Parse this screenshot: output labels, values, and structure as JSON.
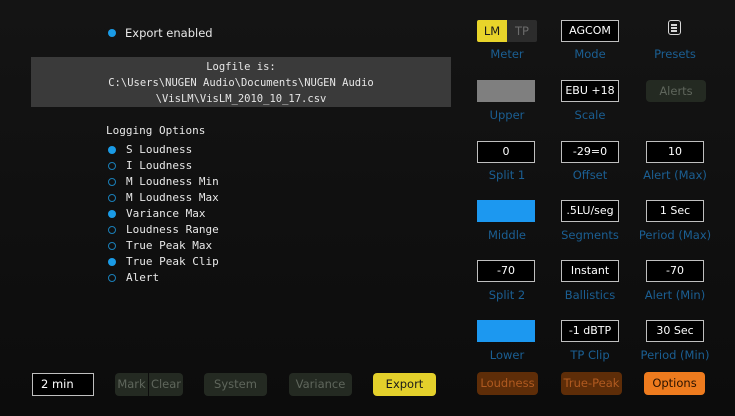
{
  "export": {
    "label": "Export enabled",
    "enabled": true
  },
  "logfile": {
    "title": "Logfile is:",
    "line1": "C:\\Users\\NUGEN Audio\\Documents\\NUGEN Audio",
    "line2": "\\VisLM\\VisLM_2010_10_17.csv"
  },
  "logging": {
    "title": "Logging Options",
    "options": [
      {
        "label": "S Loudness",
        "checked": true
      },
      {
        "label": "I Loudness",
        "checked": false
      },
      {
        "label": "M Loudness Min",
        "checked": false
      },
      {
        "label": "M Loudness Max",
        "checked": false
      },
      {
        "label": "Variance Max",
        "checked": true
      },
      {
        "label": "Loudness Range",
        "checked": false
      },
      {
        "label": "True Peak Max",
        "checked": false
      },
      {
        "label": "True Peak Clip",
        "checked": true
      },
      {
        "label": "Alert",
        "checked": false
      }
    ]
  },
  "meter": {
    "lm": "LM",
    "tp": "TP",
    "label": "Meter"
  },
  "mode": {
    "value": "AGCOM",
    "label": "Mode"
  },
  "presets": {
    "label": "Presets",
    "icon": "presets-list-icon"
  },
  "upper": {
    "label": "Upper",
    "color": "#7f7f7f"
  },
  "scale": {
    "value": "EBU +18",
    "label": "Scale"
  },
  "alerts": {
    "label": "Alerts"
  },
  "split1": {
    "value": "0",
    "label": "Split 1"
  },
  "offset": {
    "value": "-29=0",
    "label": "Offset"
  },
  "alert_max": {
    "value": "10",
    "label": "Alert (Max)"
  },
  "middle": {
    "label": "Middle",
    "color": "#1c98f0"
  },
  "segments": {
    "value": ".5LU/seg",
    "label": "Segments"
  },
  "period_max": {
    "value": "1 Sec",
    "label": "Period (Max)"
  },
  "split2": {
    "value": "-70",
    "label": "Split 2"
  },
  "ballistics": {
    "value": "Instant",
    "label": "Ballistics"
  },
  "alert_min": {
    "value": "-70",
    "label": "Alert (Min)"
  },
  "lower": {
    "label": "Lower",
    "color": "#1c98f0"
  },
  "tp_clip": {
    "value": "-1 dBTP",
    "label": "TP Clip"
  },
  "period_min": {
    "value": "30 Sec",
    "label": "Period (Min)"
  },
  "bottom": {
    "time_value": "2 min",
    "mark": "Mark",
    "clear": "Clear",
    "system": "System",
    "variance": "Variance",
    "export": "Export",
    "loudness": "Loudness",
    "true_peak": "True-Peak",
    "options": "Options"
  },
  "colors": {
    "accent_blue": "#1a9be6",
    "label_blue": "#1b5f93",
    "lm_yellow": "#e8d42a",
    "export_yellow": "#e3d02b",
    "options_orange": "#ee7b1e"
  }
}
